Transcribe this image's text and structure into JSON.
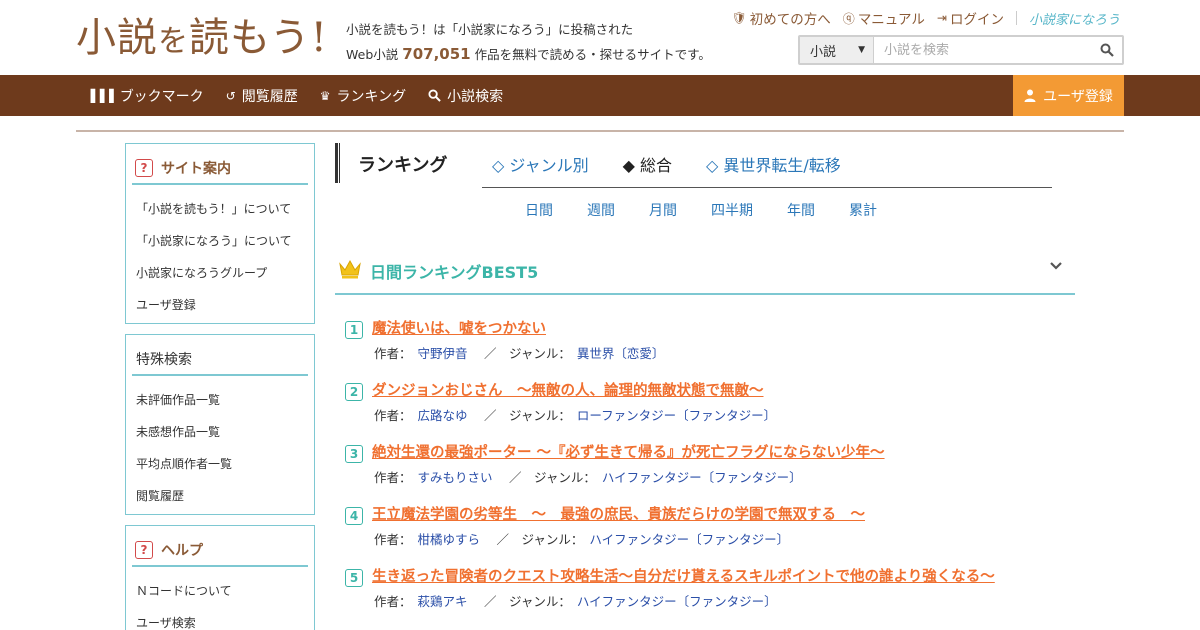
{
  "header": {
    "logo_main": "小説",
    "logo_small": "を",
    "logo_rest": "読もう!",
    "tagline_line1": "小説を読もう！は「小説家になろう」に投稿された",
    "tagline_prefix": "Web小説",
    "work_count": "707,051",
    "tagline_suffix": "作品を無料で読める・探せるサイトです。",
    "links": {
      "first_time": "初めての方へ",
      "manual": "マニュアル",
      "login": "ログイン",
      "narou": "小説家になろう"
    },
    "search": {
      "type_value": "小説",
      "placeholder": "小説を検索"
    }
  },
  "navbar": {
    "items": [
      "ブックマーク",
      "閲覧履歴",
      "ランキング",
      "小説検索"
    ],
    "register": "ユーザ登録"
  },
  "sidebar": {
    "site_guide": {
      "title": "サイト案内",
      "items": [
        "「小説を読もう！」について",
        "「小説家になろう」について",
        "小説家になろうグループ",
        "ユーザ登録"
      ]
    },
    "special_search": {
      "title": "特殊検索",
      "items": [
        "未評価作品一覧",
        "未感想作品一覧",
        "平均点順作者一覧",
        "閲覧履歴"
      ]
    },
    "help": {
      "title": "ヘルプ",
      "items": [
        "Ｎコードについて",
        "ユーザ検索"
      ]
    }
  },
  "ranking": {
    "title": "ランキング",
    "tabs": [
      "◇ ジャンル別",
      "◆ 総合",
      "◇ 異世界転生/転移"
    ],
    "periods": [
      "日間",
      "週間",
      "月間",
      "四半期",
      "年間",
      "累計"
    ],
    "best_title": "日間ランキングBEST5",
    "author_label": "作者：",
    "genre_label": "ジャンル：",
    "entries": [
      {
        "rank": "1",
        "title": "魔法使いは、嘘をつかない",
        "author": "守野伊音",
        "genre": "異世界〔恋愛〕"
      },
      {
        "rank": "2",
        "title": "ダンジョンおじさん　～無敵の人、論理的無敵状態で無敵～",
        "author": "広路なゆ",
        "genre": "ローファンタジー〔ファンタジー〕"
      },
      {
        "rank": "3",
        "title": "絶対生還の最強ポーター ～『必ず生きて帰る』が死亡フラグにならない少年～",
        "author": "すみもりさい",
        "genre": "ハイファンタジー〔ファンタジー〕"
      },
      {
        "rank": "4",
        "title": "王立魔法学園の劣等生　～　最強の庶民、貴族だらけの学園で無双する　～",
        "author": "柑橘ゆすら",
        "genre": "ハイファンタジー〔ファンタジー〕"
      },
      {
        "rank": "5",
        "title": "生き返った冒険者のクエスト攻略生活～自分だけ貰えるスキルポイントで他の誰より強くなる～",
        "author": "萩鶏アキ",
        "genre": "ハイファンタジー〔ファンタジー〕"
      }
    ]
  },
  "colors": {
    "brand_brown": "#6e3a1c",
    "register_orange": "#f39a34",
    "teal": "#3cb5a8",
    "title_orange": "#f07030",
    "link_blue": "#2b77b8"
  }
}
